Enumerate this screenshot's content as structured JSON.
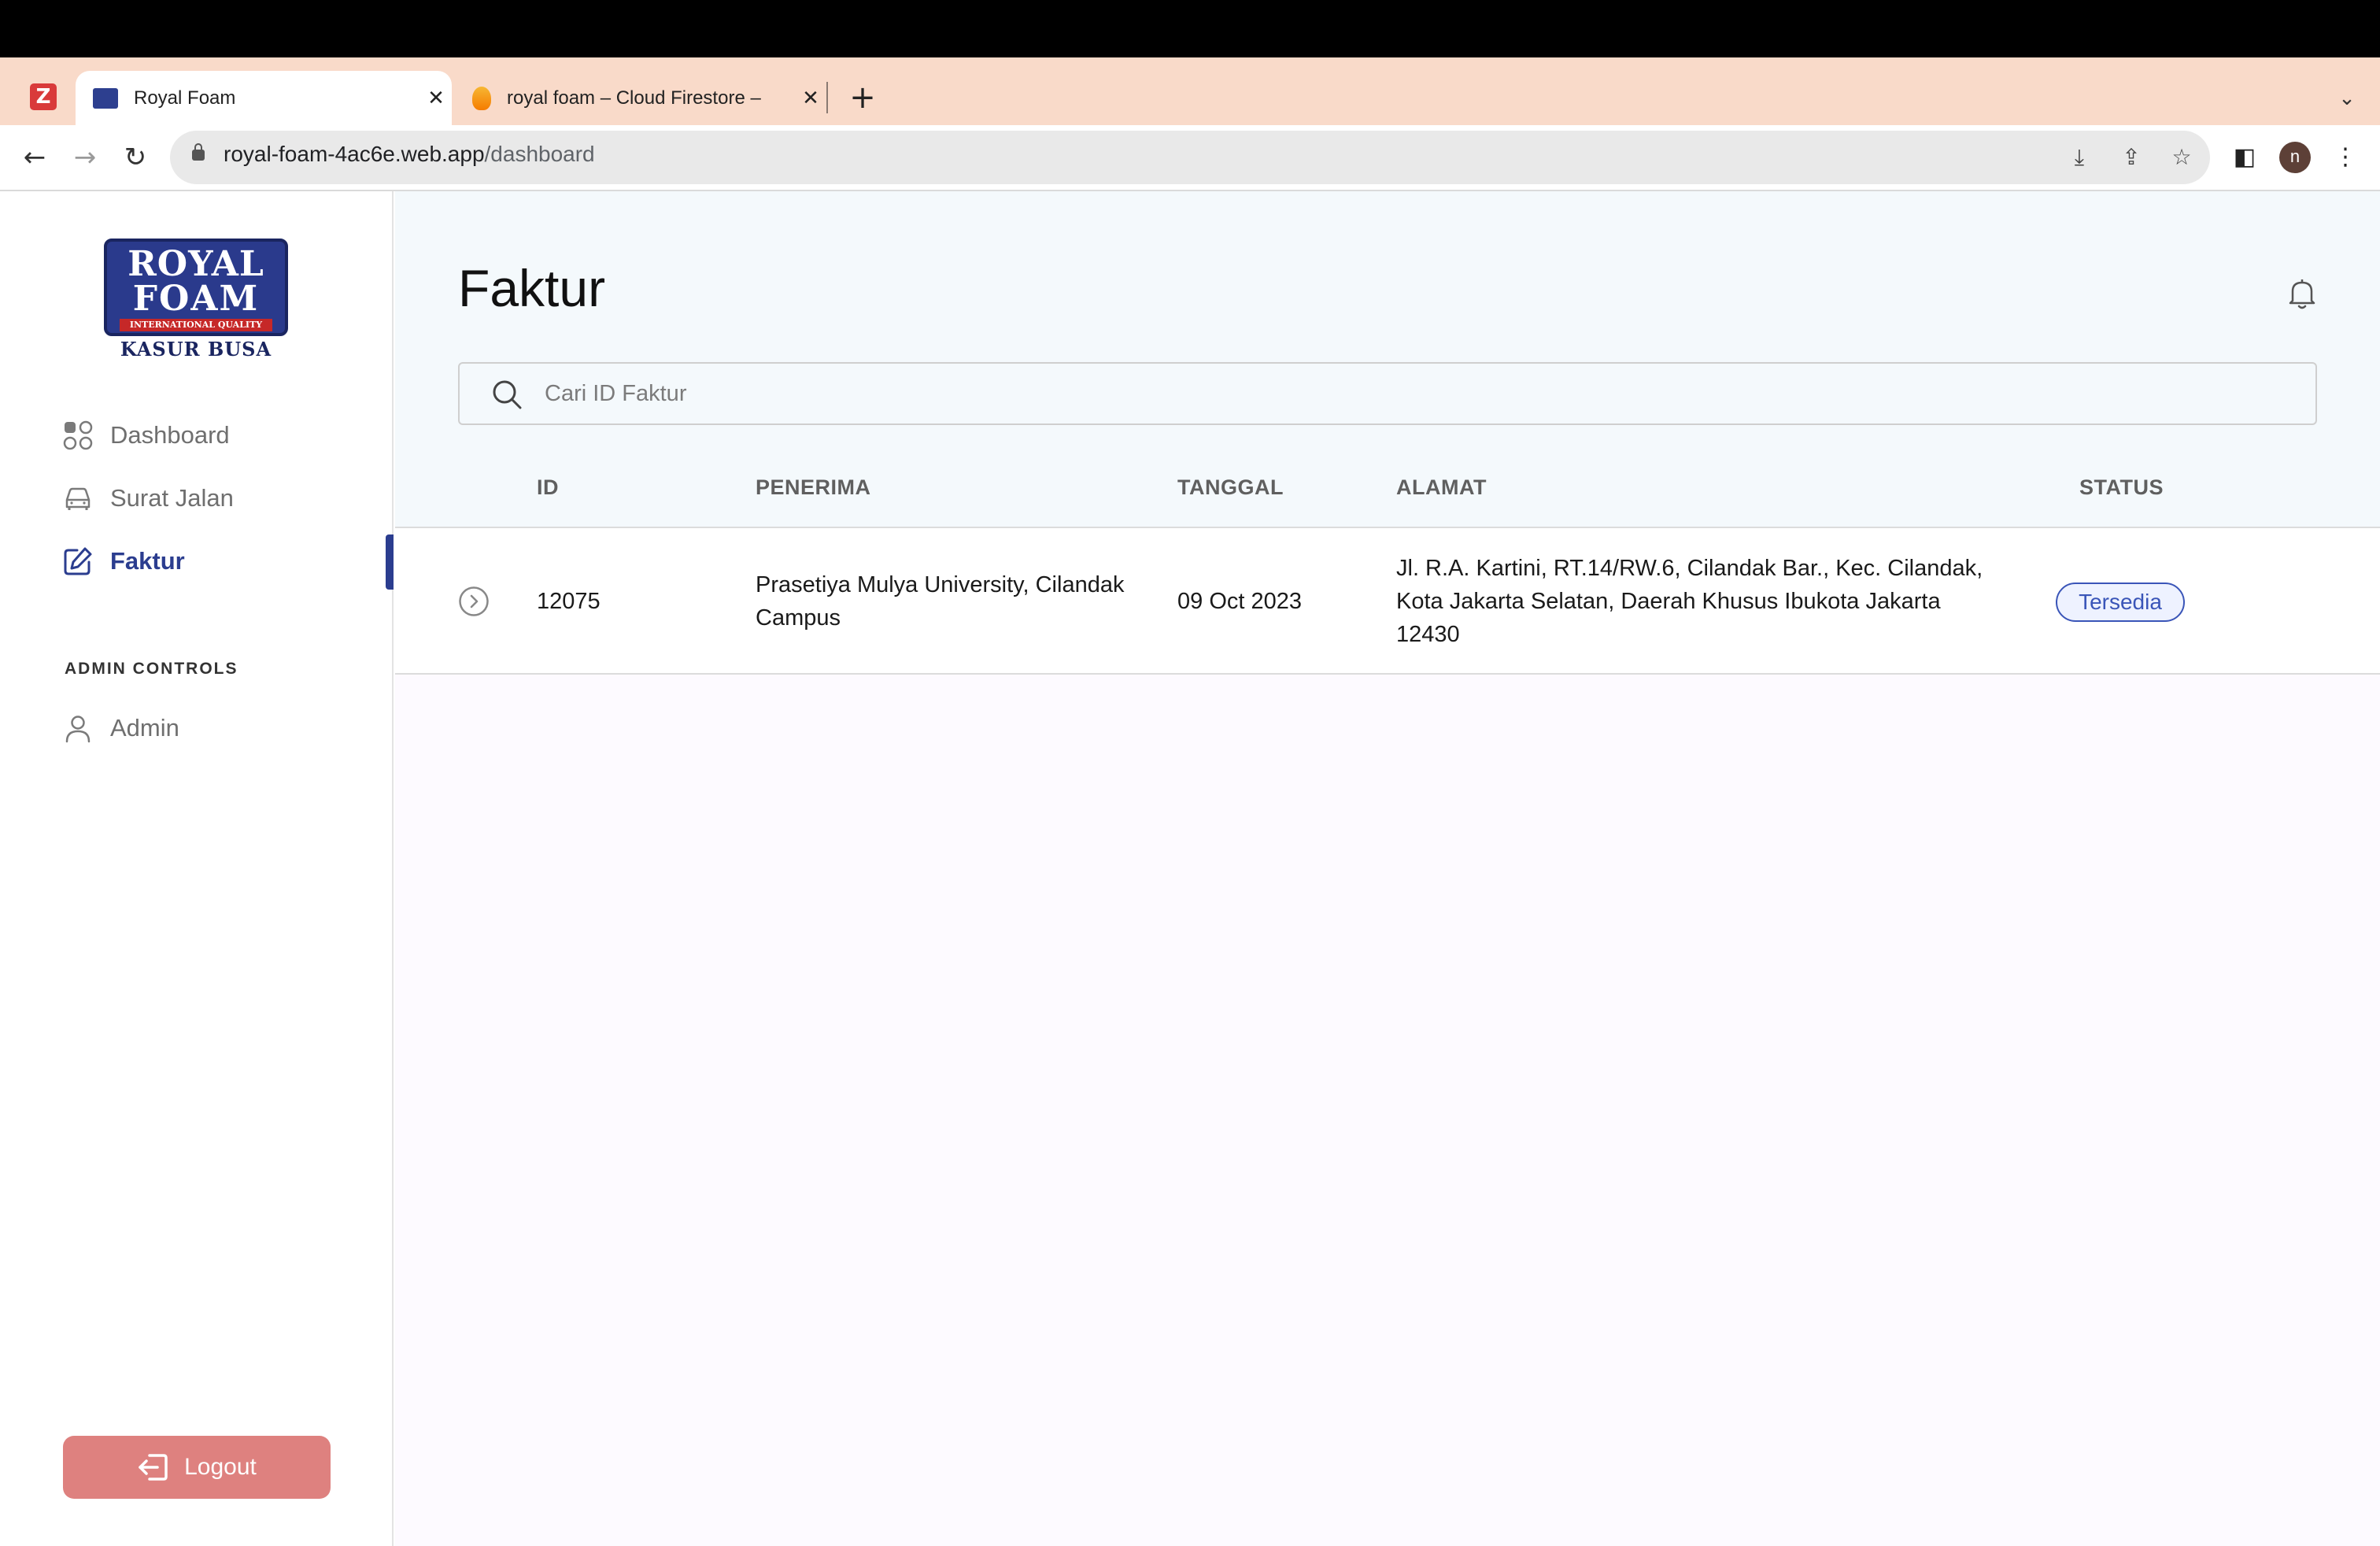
{
  "browser": {
    "tabs": [
      {
        "title": "Royal Foam",
        "active": true
      },
      {
        "title": "royal foam – Cloud Firestore –",
        "active": false
      }
    ],
    "url_host": "royal-foam-4ac6e.web.app",
    "url_path": "/dashboard",
    "profile_initial": "n"
  },
  "sidebar": {
    "logo": {
      "line1": "ROYAL",
      "line2": "FOAM",
      "quality": "INTERNATIONAL QUALITY",
      "sub": "KASUR BUSA"
    },
    "items": [
      {
        "label": "Dashboard",
        "icon": "grid-icon"
      },
      {
        "label": "Surat Jalan",
        "icon": "car-icon"
      },
      {
        "label": "Faktur",
        "icon": "edit-icon",
        "active": true
      }
    ],
    "section_label": "ADMIN CONTROLS",
    "admin_item": {
      "label": "Admin",
      "icon": "user-icon"
    },
    "logout_label": "Logout"
  },
  "main": {
    "title": "Faktur",
    "search_placeholder": "Cari ID Faktur",
    "columns": [
      "ID",
      "PENERIMA",
      "TANGGAL",
      "ALAMAT",
      "STATUS"
    ],
    "rows": [
      {
        "id": "12075",
        "penerima_line1": "Prasetiya Mulya University, Cilandak",
        "penerima_line2": "Campus",
        "tanggal": "09 Oct 2023",
        "alamat_line1": "Jl. R.A. Kartini, RT.14/RW.6, Cilandak Bar., Kec. Cilandak,",
        "alamat_line2": "Kota Jakarta Selatan, Daerah Khusus Ibukota Jakarta",
        "alamat_line3": "12430",
        "status": "Tersedia"
      }
    ]
  },
  "colors": {
    "brand": "#2b3d8f",
    "logout": "#de817f",
    "status_border": "#3a55b8",
    "tabstrip": "#f9dac9"
  }
}
